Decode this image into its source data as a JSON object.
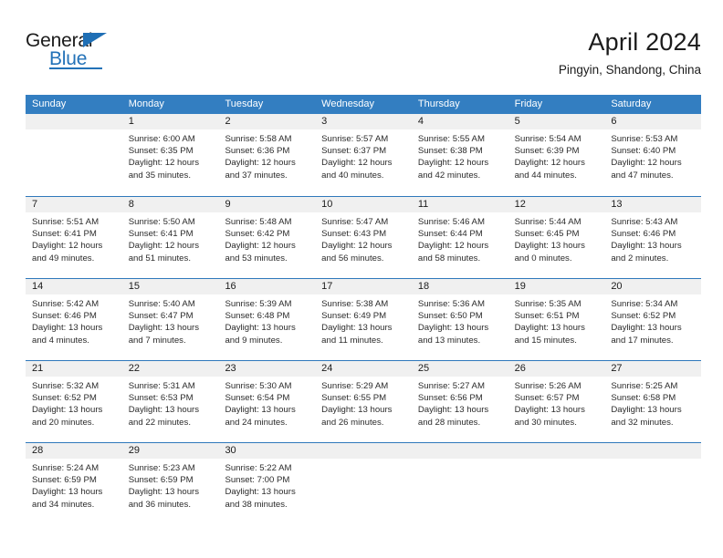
{
  "brand": {
    "name_part1": "General",
    "name_part2": "Blue",
    "triangle_icon": "blue-triangle-icon",
    "accent_color": "#2372b8"
  },
  "header": {
    "title": "April 2024",
    "subtitle": "Pingyin, Shandong, China"
  },
  "calendar": {
    "header_bg": "#337ec1",
    "daynum_bg": "#f0f0f0",
    "row_divider": "#2f78bb",
    "weekdays": [
      "Sunday",
      "Monday",
      "Tuesday",
      "Wednesday",
      "Thursday",
      "Friday",
      "Saturday"
    ],
    "weeks": [
      [
        {
          "day": "",
          "lines": []
        },
        {
          "day": "1",
          "lines": [
            "Sunrise: 6:00 AM",
            "Sunset: 6:35 PM",
            "Daylight: 12 hours",
            "and 35 minutes."
          ]
        },
        {
          "day": "2",
          "lines": [
            "Sunrise: 5:58 AM",
            "Sunset: 6:36 PM",
            "Daylight: 12 hours",
            "and 37 minutes."
          ]
        },
        {
          "day": "3",
          "lines": [
            "Sunrise: 5:57 AM",
            "Sunset: 6:37 PM",
            "Daylight: 12 hours",
            "and 40 minutes."
          ]
        },
        {
          "day": "4",
          "lines": [
            "Sunrise: 5:55 AM",
            "Sunset: 6:38 PM",
            "Daylight: 12 hours",
            "and 42 minutes."
          ]
        },
        {
          "day": "5",
          "lines": [
            "Sunrise: 5:54 AM",
            "Sunset: 6:39 PM",
            "Daylight: 12 hours",
            "and 44 minutes."
          ]
        },
        {
          "day": "6",
          "lines": [
            "Sunrise: 5:53 AM",
            "Sunset: 6:40 PM",
            "Daylight: 12 hours",
            "and 47 minutes."
          ]
        }
      ],
      [
        {
          "day": "7",
          "lines": [
            "Sunrise: 5:51 AM",
            "Sunset: 6:41 PM",
            "Daylight: 12 hours",
            "and 49 minutes."
          ]
        },
        {
          "day": "8",
          "lines": [
            "Sunrise: 5:50 AM",
            "Sunset: 6:41 PM",
            "Daylight: 12 hours",
            "and 51 minutes."
          ]
        },
        {
          "day": "9",
          "lines": [
            "Sunrise: 5:48 AM",
            "Sunset: 6:42 PM",
            "Daylight: 12 hours",
            "and 53 minutes."
          ]
        },
        {
          "day": "10",
          "lines": [
            "Sunrise: 5:47 AM",
            "Sunset: 6:43 PM",
            "Daylight: 12 hours",
            "and 56 minutes."
          ]
        },
        {
          "day": "11",
          "lines": [
            "Sunrise: 5:46 AM",
            "Sunset: 6:44 PM",
            "Daylight: 12 hours",
            "and 58 minutes."
          ]
        },
        {
          "day": "12",
          "lines": [
            "Sunrise: 5:44 AM",
            "Sunset: 6:45 PM",
            "Daylight: 13 hours",
            "and 0 minutes."
          ]
        },
        {
          "day": "13",
          "lines": [
            "Sunrise: 5:43 AM",
            "Sunset: 6:46 PM",
            "Daylight: 13 hours",
            "and 2 minutes."
          ]
        }
      ],
      [
        {
          "day": "14",
          "lines": [
            "Sunrise: 5:42 AM",
            "Sunset: 6:46 PM",
            "Daylight: 13 hours",
            "and 4 minutes."
          ]
        },
        {
          "day": "15",
          "lines": [
            "Sunrise: 5:40 AM",
            "Sunset: 6:47 PM",
            "Daylight: 13 hours",
            "and 7 minutes."
          ]
        },
        {
          "day": "16",
          "lines": [
            "Sunrise: 5:39 AM",
            "Sunset: 6:48 PM",
            "Daylight: 13 hours",
            "and 9 minutes."
          ]
        },
        {
          "day": "17",
          "lines": [
            "Sunrise: 5:38 AM",
            "Sunset: 6:49 PM",
            "Daylight: 13 hours",
            "and 11 minutes."
          ]
        },
        {
          "day": "18",
          "lines": [
            "Sunrise: 5:36 AM",
            "Sunset: 6:50 PM",
            "Daylight: 13 hours",
            "and 13 minutes."
          ]
        },
        {
          "day": "19",
          "lines": [
            "Sunrise: 5:35 AM",
            "Sunset: 6:51 PM",
            "Daylight: 13 hours",
            "and 15 minutes."
          ]
        },
        {
          "day": "20",
          "lines": [
            "Sunrise: 5:34 AM",
            "Sunset: 6:52 PM",
            "Daylight: 13 hours",
            "and 17 minutes."
          ]
        }
      ],
      [
        {
          "day": "21",
          "lines": [
            "Sunrise: 5:32 AM",
            "Sunset: 6:52 PM",
            "Daylight: 13 hours",
            "and 20 minutes."
          ]
        },
        {
          "day": "22",
          "lines": [
            "Sunrise: 5:31 AM",
            "Sunset: 6:53 PM",
            "Daylight: 13 hours",
            "and 22 minutes."
          ]
        },
        {
          "day": "23",
          "lines": [
            "Sunrise: 5:30 AM",
            "Sunset: 6:54 PM",
            "Daylight: 13 hours",
            "and 24 minutes."
          ]
        },
        {
          "day": "24",
          "lines": [
            "Sunrise: 5:29 AM",
            "Sunset: 6:55 PM",
            "Daylight: 13 hours",
            "and 26 minutes."
          ]
        },
        {
          "day": "25",
          "lines": [
            "Sunrise: 5:27 AM",
            "Sunset: 6:56 PM",
            "Daylight: 13 hours",
            "and 28 minutes."
          ]
        },
        {
          "day": "26",
          "lines": [
            "Sunrise: 5:26 AM",
            "Sunset: 6:57 PM",
            "Daylight: 13 hours",
            "and 30 minutes."
          ]
        },
        {
          "day": "27",
          "lines": [
            "Sunrise: 5:25 AM",
            "Sunset: 6:58 PM",
            "Daylight: 13 hours",
            "and 32 minutes."
          ]
        }
      ],
      [
        {
          "day": "28",
          "lines": [
            "Sunrise: 5:24 AM",
            "Sunset: 6:59 PM",
            "Daylight: 13 hours",
            "and 34 minutes."
          ]
        },
        {
          "day": "29",
          "lines": [
            "Sunrise: 5:23 AM",
            "Sunset: 6:59 PM",
            "Daylight: 13 hours",
            "and 36 minutes."
          ]
        },
        {
          "day": "30",
          "lines": [
            "Sunrise: 5:22 AM",
            "Sunset: 7:00 PM",
            "Daylight: 13 hours",
            "and 38 minutes."
          ]
        },
        {
          "day": "",
          "lines": []
        },
        {
          "day": "",
          "lines": []
        },
        {
          "day": "",
          "lines": []
        },
        {
          "day": "",
          "lines": []
        }
      ]
    ]
  }
}
